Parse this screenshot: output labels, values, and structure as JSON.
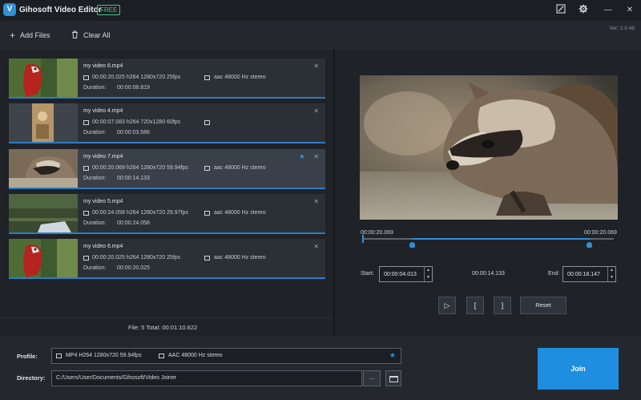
{
  "app": {
    "logo_letter": "V",
    "title": "Gihosoft Video Editor",
    "badge": "FREE",
    "version": "Ver: 2.0.48"
  },
  "window_controls": {
    "feedback_icon": "feedback-icon",
    "settings_icon": "gear-icon",
    "minimize": "—",
    "close": "✕"
  },
  "toolbar": {
    "add_files": "Add Files",
    "clear_all": "Clear All"
  },
  "files": [
    {
      "name": "my video 6.mp4",
      "video": "00:00:20.025 h264 1280x720 25fps",
      "audio": "aac 48000 Hz stereo",
      "duration_label": "Duration:",
      "duration": "00:00:08.819",
      "starred": false,
      "selected": false
    },
    {
      "name": "my video 4.mp4",
      "video": "00:00:07.083 h264 720x1280 60fps",
      "audio": "",
      "duration_label": "Duration:",
      "duration": "00:00:03.586",
      "starred": false,
      "selected": false
    },
    {
      "name": "my video 7.mp4",
      "video": "00:00:20.069 h264 1280x720 59.94fps",
      "audio": "aac 48000 Hz stereo",
      "duration_label": "Duration:",
      "duration": "00:00:14.133",
      "starred": true,
      "selected": true
    },
    {
      "name": "my video 5.mp4",
      "video": "00:00:24.058 h264 1280x720 29.97fps",
      "audio": "aac 48000 Hz stereo",
      "duration_label": "Duration:",
      "duration": "00:00:24.058",
      "starred": false,
      "selected": false
    },
    {
      "name": "my video 6.mp4",
      "video": "00:00:20.025 h264 1280x720 25fps",
      "audio": "aac 48000 Hz stereo",
      "duration_label": "Duration:",
      "duration": "00:00:20.025",
      "starred": false,
      "selected": false
    }
  ],
  "status": {
    "text": "File: 5  Total: 00:01:10.622"
  },
  "player": {
    "time_left": "00:00:20.069",
    "time_right": "00:00:20.069",
    "start_label": "Start:",
    "start_value": "00:00:04.013",
    "selection_duration": "00:00:14.133",
    "end_label": "End:",
    "end_value": "00:00:18.147",
    "trim_start_fraction": 0.2,
    "trim_end_fraction": 0.904,
    "play_glyph": "▷",
    "mark_in_glyph": "[",
    "mark_out_glyph": "]",
    "reset_label": "Reset"
  },
  "output": {
    "profile_label": "Profile:",
    "profile_video": "MP4 H264 1280x720 59.94fps",
    "profile_audio": "AAC 48000 Hz stereo",
    "directory_label": "Directory:",
    "directory_value": "C:/Users/User/Documents/Gihosoft/Video Joiner",
    "browse_label": "...",
    "join_label": "Join"
  },
  "colors": {
    "accent": "#2f8fd8",
    "join": "#1e8ee0",
    "badge": "#4cc38a"
  }
}
